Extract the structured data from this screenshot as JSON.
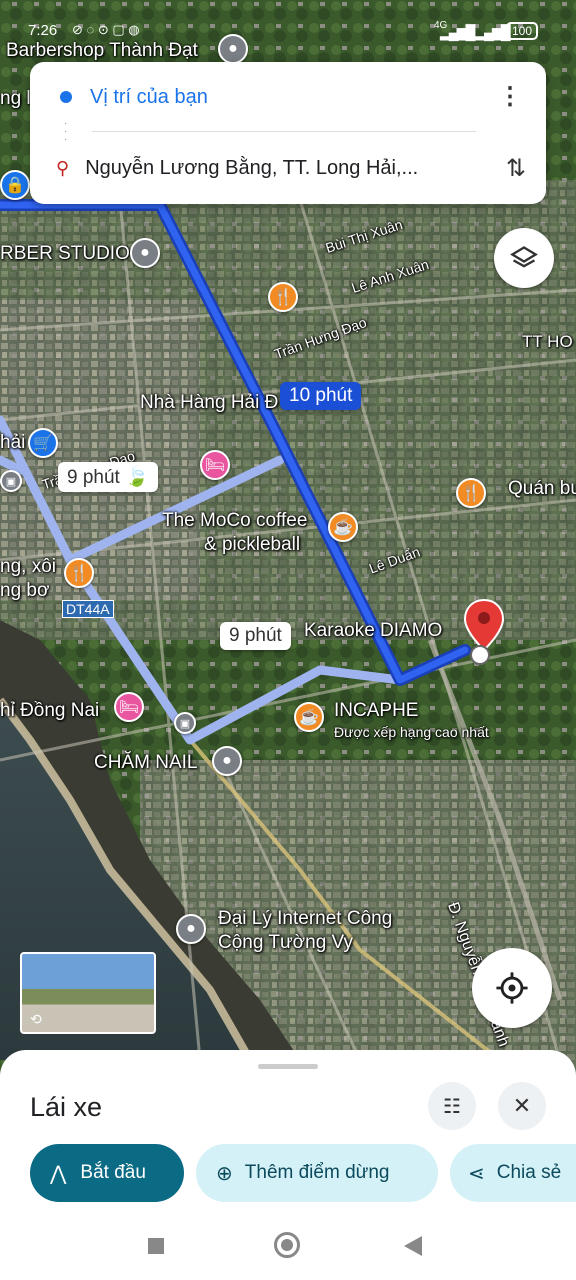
{
  "status_bar": {
    "time": "7:26",
    "network": "4G",
    "battery": "100"
  },
  "search_card": {
    "origin": "Vị trí của bạn",
    "destination": "Nguyễn Lương Bằng, TT. Long Hải,..."
  },
  "map": {
    "places": {
      "barbershop_thanh_dat": "Barbershop Thành Đạt",
      "barber_studio": "RBER STUDIO",
      "nha_hang": "Nhà Hàng Hải Đ",
      "tt_ho": "TT HO",
      "quan_bu": "Quán bu",
      "moco": "The MoCo coffee",
      "moco2": "& pickleball",
      "xoi1": "ng, xôi",
      "xoi2": "ng bơ",
      "karaoke": "Karaoke DIAMO",
      "incaphe": "INCAPHE",
      "incaphe_sub": "Được xếp hạng cao nhất",
      "dong_nai": "hỉ Đồng Nai",
      "cham_nail": "CHĂM NAIL",
      "internet1": "Đại Lý Internet Công",
      "internet2": "Cộng Tường Vy",
      "hai_left": "hải",
      "ng_left": "ng l"
    },
    "streets": {
      "bui_thi_xuan": "Bùi Thị Xuân",
      "le_anh_xuan": "Lê Anh Xuân",
      "tran_hung_dao": "Trần Hưng Đạo",
      "tran_hung_dao_left": "Trần Hưng Đạo",
      "le_duan": "Lê Duẩn",
      "nguyen_tat_thanh": "Đ. Nguyễn Tất Thành",
      "dt44a": "DT44A"
    },
    "routes": {
      "primary": "10 phút",
      "alt1": "9 phút",
      "alt2": "9 phút"
    }
  },
  "bottom_sheet": {
    "mode_title": "Lái xe",
    "start_label": "Bắt đầu",
    "add_stop_label": "Thêm điểm dừng",
    "share_label": "Chia sẻ"
  },
  "colors": {
    "primary_route": "#1a4fd6",
    "alt_route": "#9fb4ee",
    "start_button": "#0b6a84",
    "chip_bg": "#d4f1f7"
  }
}
